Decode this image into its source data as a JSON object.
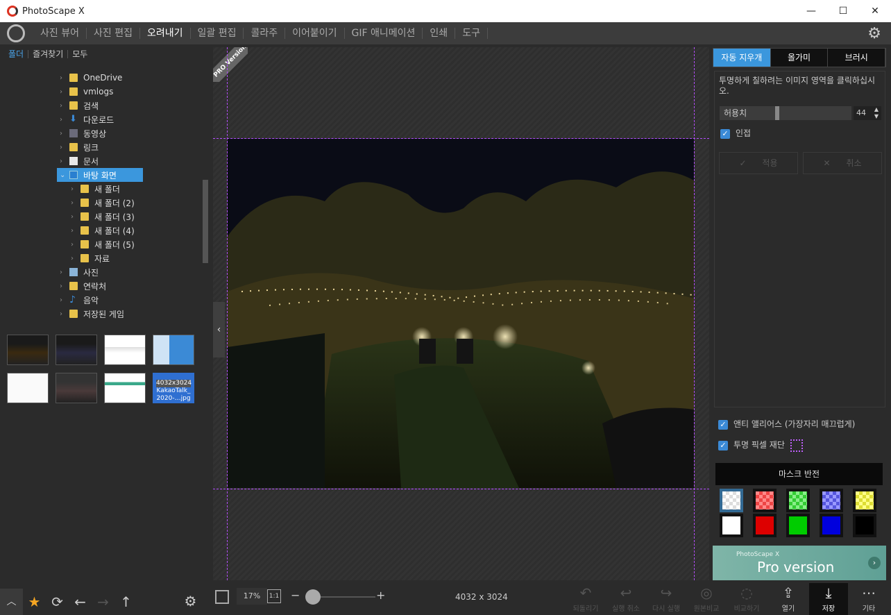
{
  "app": {
    "title": "PhotoScape X"
  },
  "window_buttons": [
    "—",
    "☐",
    "✕"
  ],
  "menu": [
    {
      "label": "사진 뷰어",
      "active": false
    },
    {
      "label": "사진 편집",
      "active": false
    },
    {
      "label": "오려내기",
      "active": true
    },
    {
      "label": "일괄 편집",
      "active": false
    },
    {
      "label": "콜라주",
      "active": false
    },
    {
      "label": "이어붙이기",
      "active": false
    },
    {
      "label": "GIF 애니메이션",
      "active": false
    },
    {
      "label": "인쇄",
      "active": false
    },
    {
      "label": "도구",
      "active": false
    }
  ],
  "left_tabs": [
    "폴더",
    "즐겨찾기",
    "모두"
  ],
  "tree": [
    {
      "label": "OneDrive",
      "icon": "folder-icon"
    },
    {
      "label": "vmlogs",
      "icon": "folder-icon"
    },
    {
      "label": "검색",
      "icon": "search-folder-icon"
    },
    {
      "label": "다운로드",
      "icon": "download-icon"
    },
    {
      "label": "동영상",
      "icon": "video-folder-icon"
    },
    {
      "label": "링크",
      "icon": "link-folder-icon"
    },
    {
      "label": "문서",
      "icon": "document-icon"
    },
    {
      "label": "바탕 화면",
      "icon": "desktop-icon",
      "selected": true
    },
    {
      "label": "새 폴더",
      "icon": "folder-icon"
    },
    {
      "label": "새 폴더 (2)",
      "icon": "folder-icon"
    },
    {
      "label": "새 폴더 (3)",
      "icon": "folder-icon"
    },
    {
      "label": "새 폴더 (4)",
      "icon": "folder-icon"
    },
    {
      "label": "새 폴더 (5)",
      "icon": "folder-icon"
    },
    {
      "label": "자료",
      "icon": "folder-icon"
    },
    {
      "label": "사진",
      "icon": "pictures-icon"
    },
    {
      "label": "연락처",
      "icon": "contacts-icon"
    },
    {
      "label": "음악",
      "icon": "music-icon"
    },
    {
      "label": "저장된 게임",
      "icon": "saved-games-icon"
    }
  ],
  "thumbnails": {
    "selected_size": "4032x3024",
    "selected_name": "KakaoTalk_ 2020-…jpg"
  },
  "canvas": {
    "pro_badge": "PRO Version"
  },
  "zoom": {
    "value": "17%",
    "one_to_one": "1:1",
    "minus": "−",
    "plus": "+"
  },
  "image_dimensions": "4032 x 3024",
  "bottom_actions": [
    {
      "label": "되돌리기",
      "icon": "revert-icon",
      "enabled": false
    },
    {
      "label": "실행 취소",
      "icon": "undo-icon",
      "enabled": false
    },
    {
      "label": "다시 실행",
      "icon": "redo-icon",
      "enabled": false
    },
    {
      "label": "원본비교",
      "icon": "compare-original-icon",
      "enabled": false
    },
    {
      "label": "비교하기",
      "icon": "compare-icon",
      "enabled": false
    },
    {
      "label": "열기",
      "icon": "open-icon",
      "enabled": true
    },
    {
      "label": "저장",
      "icon": "save-icon",
      "enabled": true
    },
    {
      "label": "기타",
      "icon": "more-icon",
      "enabled": true
    }
  ],
  "right": {
    "tabs": [
      "자동 지우개",
      "올가미",
      "브러시"
    ],
    "description": "투명하게 칠하려는 이미지 영역을 클릭하십시오.",
    "tolerance_label": "허용치",
    "tolerance_value": "44",
    "adjacent_label": "인접",
    "apply_label": "적용",
    "cancel_label": "취소",
    "antialias_label": "앤티 앨리어스 (가장자리 매끄럽게)",
    "crop_transparent_label": "투명 픽셀 재단",
    "invert_mask_label": "마스크 반전",
    "mask_colors": [
      "checker-white",
      "checker-red",
      "checker-green",
      "checker-blue",
      "checker-yellow",
      "#ffffff",
      "#dd0000",
      "#00cc00",
      "#0000dd",
      "#000000"
    ],
    "promo_small": "PhotoScape X",
    "promo_large": "Pro version"
  },
  "colors": {
    "accent": "#3b97dd",
    "guide": "#b34dff",
    "star": "#f5a623"
  }
}
